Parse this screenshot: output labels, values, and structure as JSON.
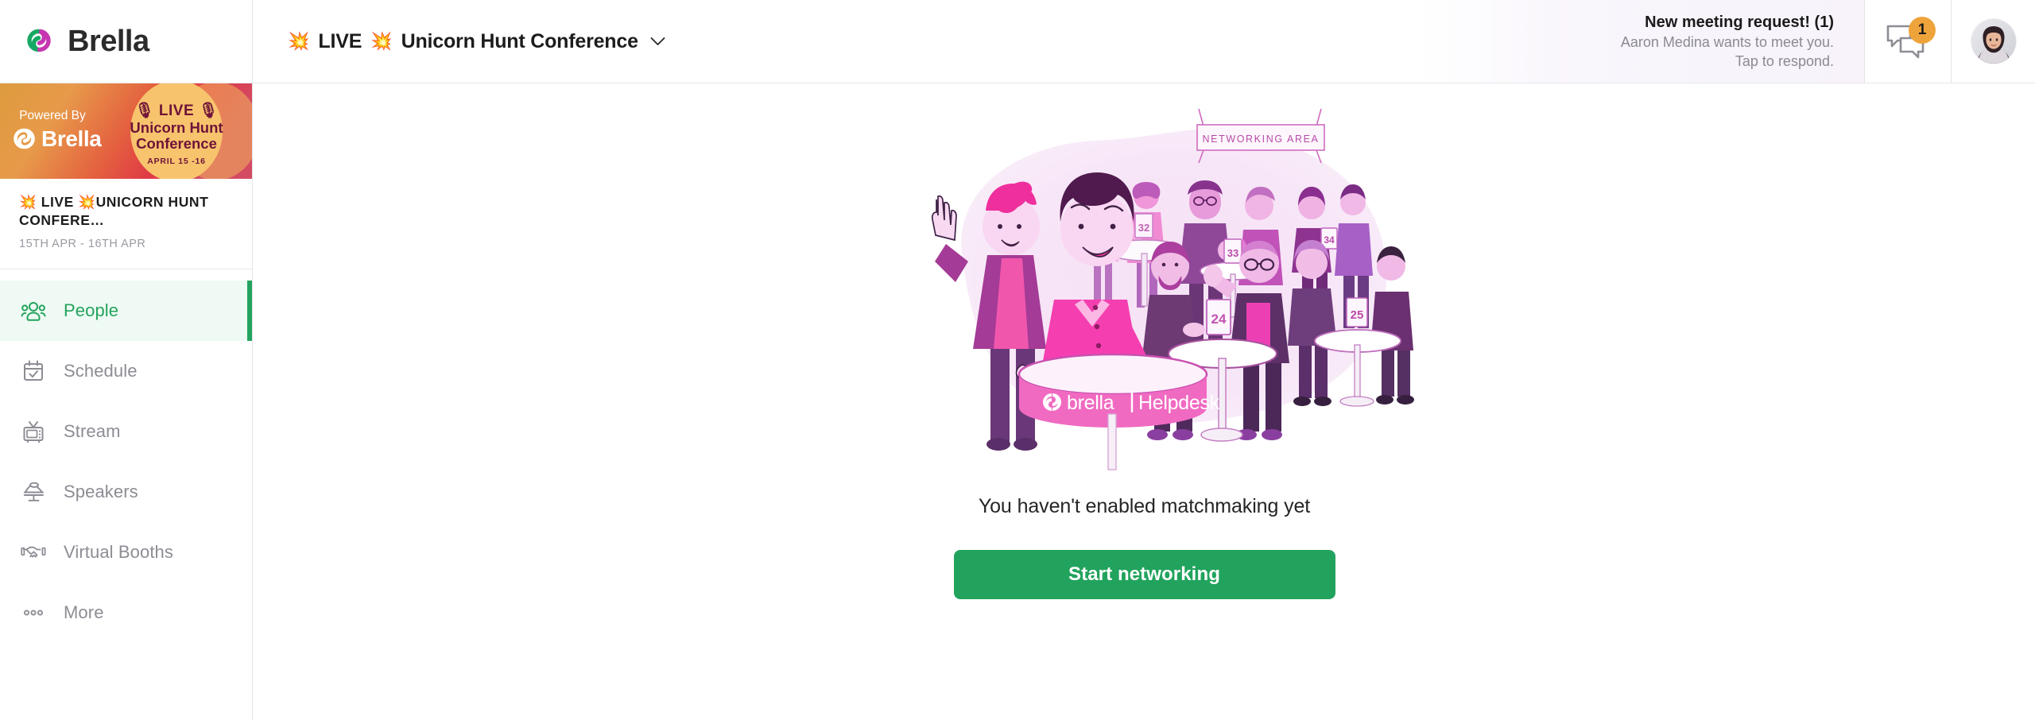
{
  "brand": {
    "name": "Brella",
    "accent_green": "#22a35d",
    "accent_magenta": "#c636b0",
    "badge_orange": "#eea43a",
    "logo_icon": "brella-interlocking-circles-icon"
  },
  "header": {
    "event_title": "LIVE  Unicorn Hunt Conference",
    "event_title_emoji_1": "💥",
    "event_title_emoji_2": "💥",
    "event_title_text_a": "LIVE",
    "event_title_text_b": "Unicorn Hunt Conference",
    "dropdown_icon": "chevron-down-icon",
    "notification": {
      "title": "New meeting request! (1)",
      "line1": "Aaron Medina wants to meet you.",
      "line2": "Tap to respond."
    },
    "chat": {
      "icon": "chat-bubbles-icon",
      "unread_count": "1"
    },
    "avatar": {
      "icon": "user-avatar",
      "alt": "Profile photo"
    }
  },
  "sidebar": {
    "banner": {
      "powered_by": "Powered By",
      "brand": "Brella",
      "badge_live": "LIVE",
      "badge_line1": "Unicorn Hunt",
      "badge_line2": "Conference",
      "badge_dates": "APRIL 15 -16",
      "mic_emoji": "🎙"
    },
    "event": {
      "name": "💥 LIVE 💥UNICORN HUNT CONFERE…",
      "dates": "15TH APR - 16TH APR"
    },
    "items": [
      {
        "label": "People",
        "icon": "people-icon",
        "active": true
      },
      {
        "label": "Schedule",
        "icon": "calendar-check-icon",
        "active": false
      },
      {
        "label": "Stream",
        "icon": "tv-icon",
        "active": false
      },
      {
        "label": "Speakers",
        "icon": "podium-icon",
        "active": false
      },
      {
        "label": "Virtual Booths",
        "icon": "handshake-icon",
        "active": false
      },
      {
        "label": "More",
        "icon": "ellipsis-icon",
        "active": false
      }
    ]
  },
  "main": {
    "illustration": {
      "name": "networking-illustration",
      "sign_label": "NETWORKING AREA",
      "helpdesk_label": "brella | Helpdesk",
      "table_numbers": [
        "24",
        "25",
        "32",
        "33",
        "34"
      ]
    },
    "empty_state_title": "You haven't enabled matchmaking yet",
    "cta_label": "Start networking"
  }
}
